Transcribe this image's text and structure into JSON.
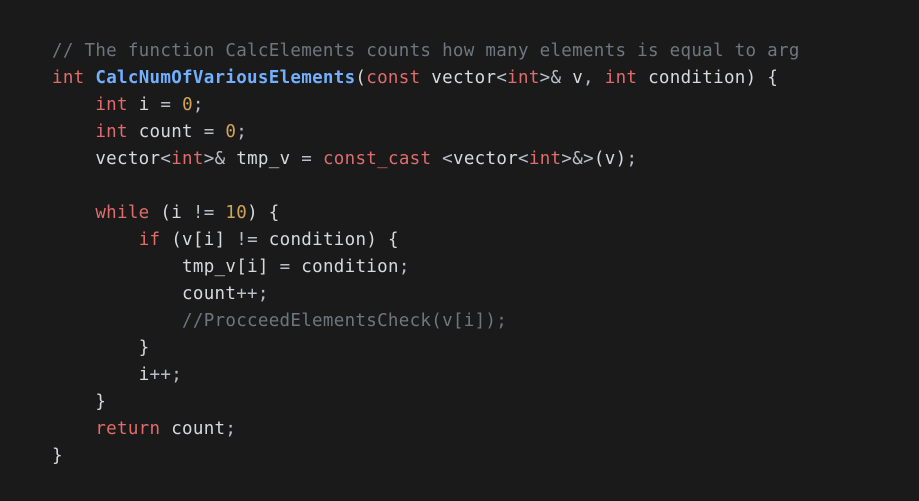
{
  "code": {
    "line1_comment": "// The function CalcElements counts how many elements is equal to arg",
    "kw_int": "int",
    "func_name": "CalcNumOfVariousElements",
    "kw_const": "const",
    "type_vector_open": "vector",
    "type_int": "int",
    "amp": "&",
    "param_v": "v",
    "comma": ",",
    "param_condition": "condition",
    "brace_open": "{",
    "brace_close": "}",
    "ident_i": "i",
    "eq": "=",
    "num_zero": "0",
    "semicolon": ";",
    "ident_count": "count",
    "ident_tmp_v": "tmp_v",
    "kw_const_cast": "const_cast",
    "paren_open": "(",
    "paren_close": ")",
    "angle_open": "<",
    "angle_close": ">",
    "kw_while": "while",
    "ne": "!=",
    "num_ten": "10",
    "kw_if": "if",
    "bracket_open": "[",
    "bracket_close": "]",
    "plusplus": "++",
    "line_commented_call": "//ProcceedElementsCheck(v[i]);",
    "kw_return": "return"
  }
}
